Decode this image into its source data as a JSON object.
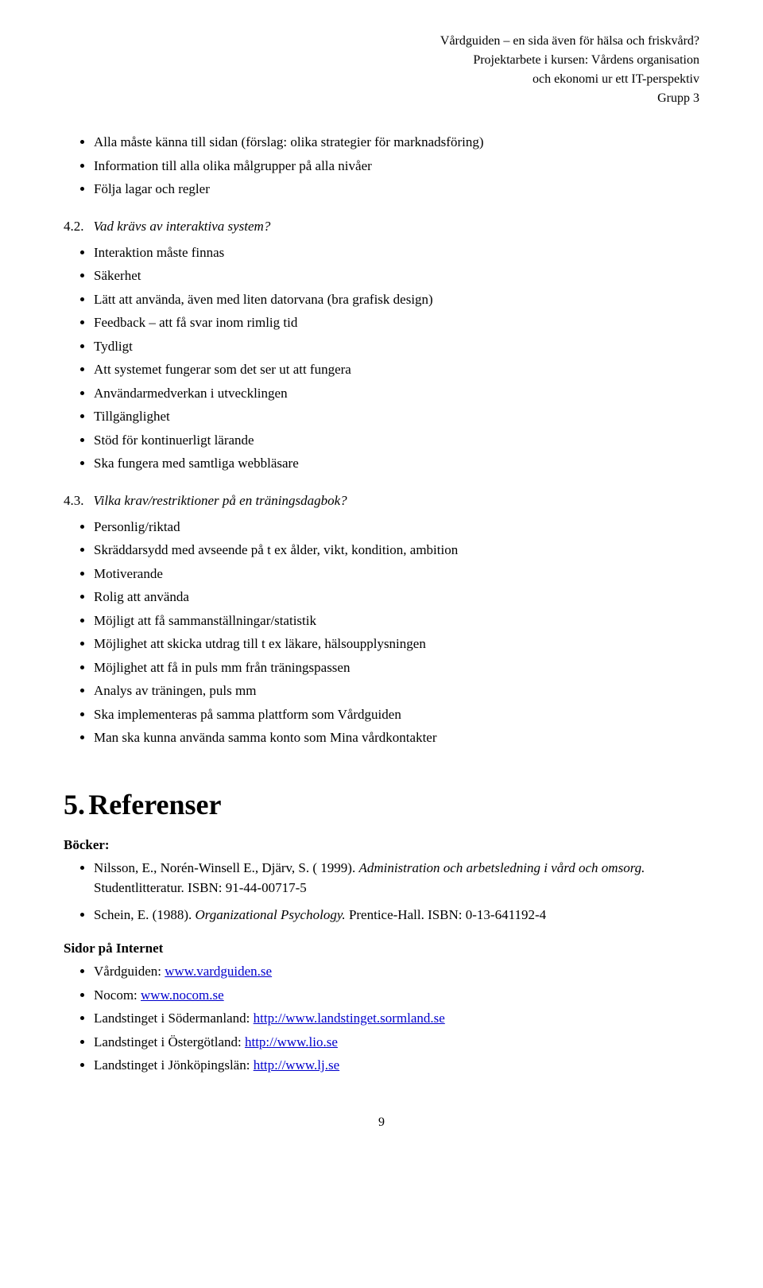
{
  "header": {
    "line1": "Vårdguiden – en sida även för hälsa och friskvård?",
    "line2": "Projektarbete i kursen: Vårdens organisation",
    "line3": "och ekonomi ur ett IT-perspektiv",
    "line4": "Grupp 3"
  },
  "top_bullets": {
    "items": [
      "Alla måste känna till sidan (förslag: olika strategier för marknadsföring)",
      "Information till alla olika målgrupper på alla nivåer",
      "Följa lagar och regler"
    ]
  },
  "section_42": {
    "number": "4.2.",
    "title": "Vad krävs av interaktiva system?"
  },
  "interaktiva_bullets": {
    "items": [
      "Interaktion måste finnas",
      "Säkerhet",
      "Lätt att använda, även med liten datorvana (bra grafisk design)",
      "Feedback – att få svar inom rimlig tid",
      "Tydligt",
      "Att systemet fungerar som det ser ut att fungera",
      "Användarmedverkan i utvecklingen",
      "Tillgänglighet",
      "Stöd för kontinuerligt lärande",
      "Ska fungera med samtliga webbläsare"
    ]
  },
  "section_43": {
    "number": "4.3.",
    "title": "Vilka krav/restriktioner på en träningsdagbok?"
  },
  "traningsdagbok_bullets": {
    "items": [
      "Personlig/riktad",
      "Skräddarsydd med avseende på t ex ålder, vikt, kondition, ambition",
      "Motiverande",
      "Rolig att använda",
      "Möjligt att få sammanställningar/statistik",
      "Möjlighet att skicka utdrag till t ex läkare, hälsoupplysningen",
      "Möjlighet att få in puls mm från träningspassen",
      "Analys av träningen, puls mm",
      "Ska implementeras på samma plattform som Vårdguiden",
      "Man ska kunna använda samma konto som Mina vårdkontakter"
    ]
  },
  "section_5": {
    "number": "5.",
    "title": "Referenser"
  },
  "references": {
    "books_label": "Böcker:",
    "book1_normal": "Nilsson, E., Norén-Winsell E., Djärv, S. ( 1999).",
    "book1_italic": "Administration och arbetsledning i vård och omsorg.",
    "book1_end": "Studentlitteratur. ISBN: 91-44-00717-5",
    "book2_normal": "Schein, E. (1988).",
    "book2_italic": "Organizational Psychology.",
    "book2_end": "Prentice-Hall. ISBN: 0-13-641192-4",
    "internet_label": "Sidor på Internet",
    "internet_items": [
      {
        "label": "Vårdguiden:",
        "url": "www.vardguiden.se",
        "href": "http://www.vardguiden.se"
      },
      {
        "label": "Nocom:",
        "url": "www.nocom.se",
        "href": "http://www.nocom.se"
      },
      {
        "label": "Landstinget i Södermanland:",
        "url": "http://www.landstinget.sormland.se",
        "href": "http://www.landstinget.sormland.se"
      },
      {
        "label": "Landstinget i Östergötland:",
        "url": "http://www.lio.se",
        "href": "http://www.lio.se"
      },
      {
        "label": "Landstinget i Jönköpingslän:",
        "url": "http://www.lj.se",
        "href": "http://www.lj.se"
      }
    ]
  },
  "page_number": "9"
}
